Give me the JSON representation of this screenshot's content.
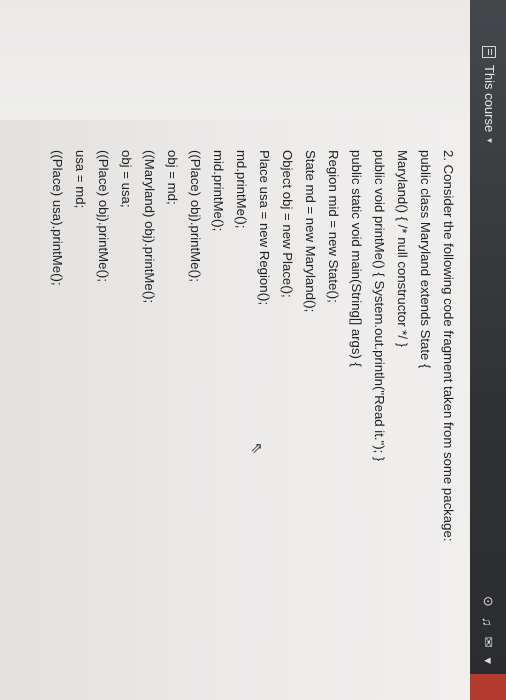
{
  "header": {
    "breadcrumb_label": "This course",
    "breadcrumb_caret": "▾",
    "icons": [
      "course-icon",
      "info-icon",
      "bell-icon",
      "mail-icon",
      "menu-caret-icon"
    ]
  },
  "question": {
    "title": "2. Consider the following code fragment taken from some package:",
    "lines": [
      "public class Maryland extends State {",
      "Maryland() { /* null constructor */ }",
      "public void printMe() { System.out.println(\"Read it.\"); }",
      "public static void main(String[] args) {",
      "Region mid = new State();",
      "State md = new Maryland();",
      "Object obj = new Place();",
      "Place usa = new Region();",
      "md.printMe();",
      "mid.printMe();",
      "((Place) obj).printMe();",
      "obj = md;",
      "((Maryland) obj).printMe();",
      "obj = usa;",
      "((Place) obj).printMe();",
      "usa = md;",
      "((Place) usa).printMe();"
    ]
  },
  "colors": {
    "topbar": "#2f3134",
    "accent": "#b33a2e",
    "page": "#eeeceb",
    "text": "#202020"
  }
}
